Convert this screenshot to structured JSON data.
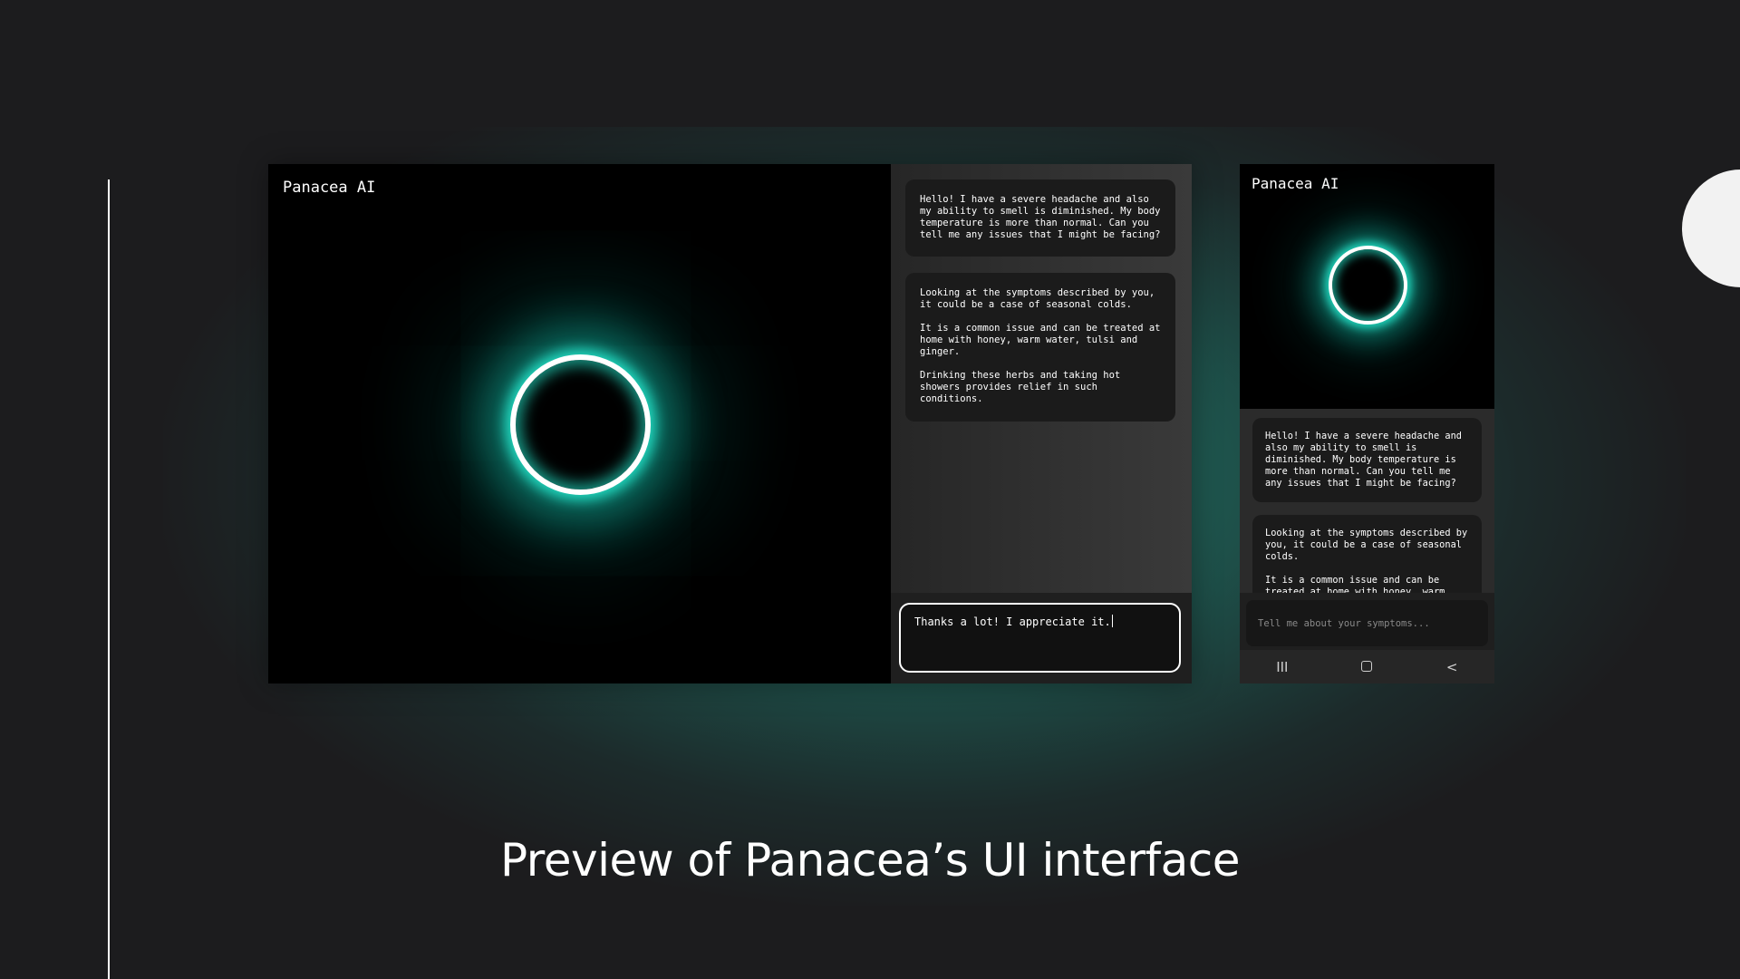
{
  "slide": {
    "caption": "Preview of Panacea’s UI interface"
  },
  "desktop": {
    "app_title": "Panacea AI",
    "messages": [
      "Hello! I have a severe headache and also my ability to smell is diminished. My body temperature is more than normal. Can you tell me any issues that I might be facing?",
      "Looking at the symptoms described by you, it could be a case of seasonal colds.\n\nIt is a common issue and can be treated at home with honey, warm water, tulsi and ginger.\n\nDrinking these herbs and taking hot showers provides relief in such conditions."
    ],
    "input_value": "Thanks a lot! I appreciate it."
  },
  "mobile": {
    "app_title": "Panacea AI",
    "messages": [
      "Hello! I have a severe headache and also my ability to smell is diminished. My body temperature is more than normal. Can you tell me any issues that I might be facing?",
      "Looking at the symptoms described by you, it could be a case of seasonal colds.\n\nIt is a common issue and can be treated at home with honey, warm"
    ],
    "input_placeholder": "Tell me about your symptoms...",
    "nav": {
      "recent_glyph": "III",
      "back_glyph": "<"
    }
  },
  "colors": {
    "accent_glow": "#22d8bf",
    "background": "#1c1c1e",
    "ring": "#ffffff"
  },
  "icons": [
    "recent-apps-icon",
    "home-icon",
    "back-icon"
  ]
}
